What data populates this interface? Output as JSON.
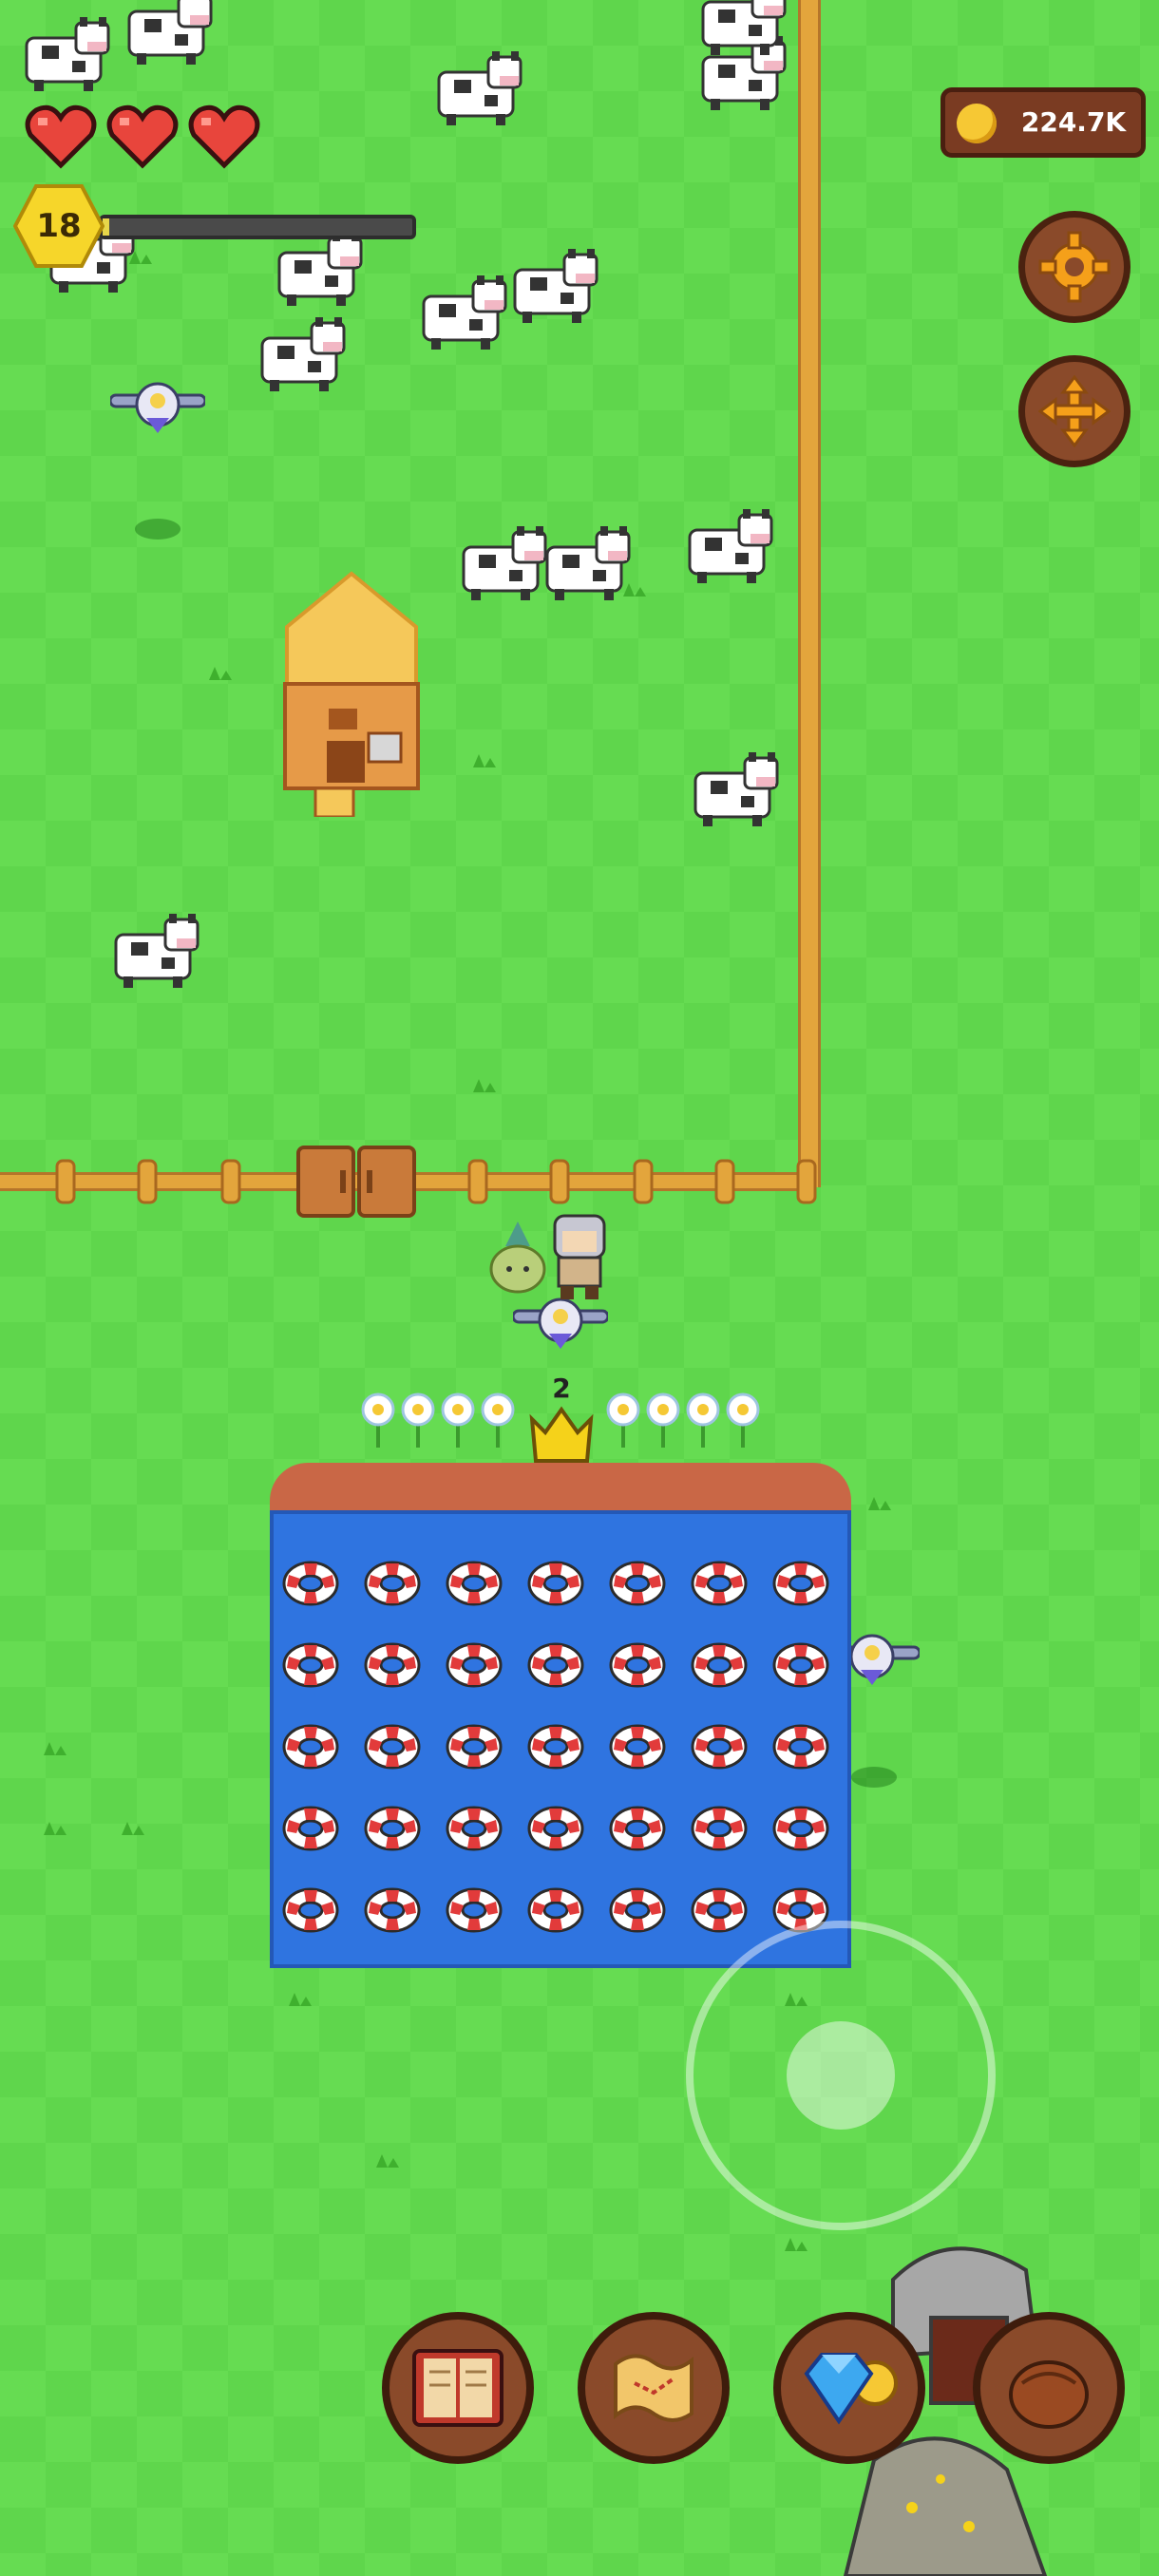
{
  "hud": {
    "level": "18",
    "xp_fraction": 0.02,
    "hearts": 3,
    "coins": "224.7K"
  },
  "icons": {
    "settings": "gear-icon",
    "move": "move-arrows-icon",
    "journal": "book-icon",
    "map": "map-scroll-icon",
    "shop": "diamond-coin-icon",
    "inventory": "leather-bag-icon"
  },
  "colors": {
    "grass": "#66dc52",
    "water": "#2f74e0",
    "wood": "#8a4a2a",
    "gold": "#f6c834"
  },
  "pond": {
    "level_badge": "2",
    "rows": 5,
    "cols": 7
  }
}
